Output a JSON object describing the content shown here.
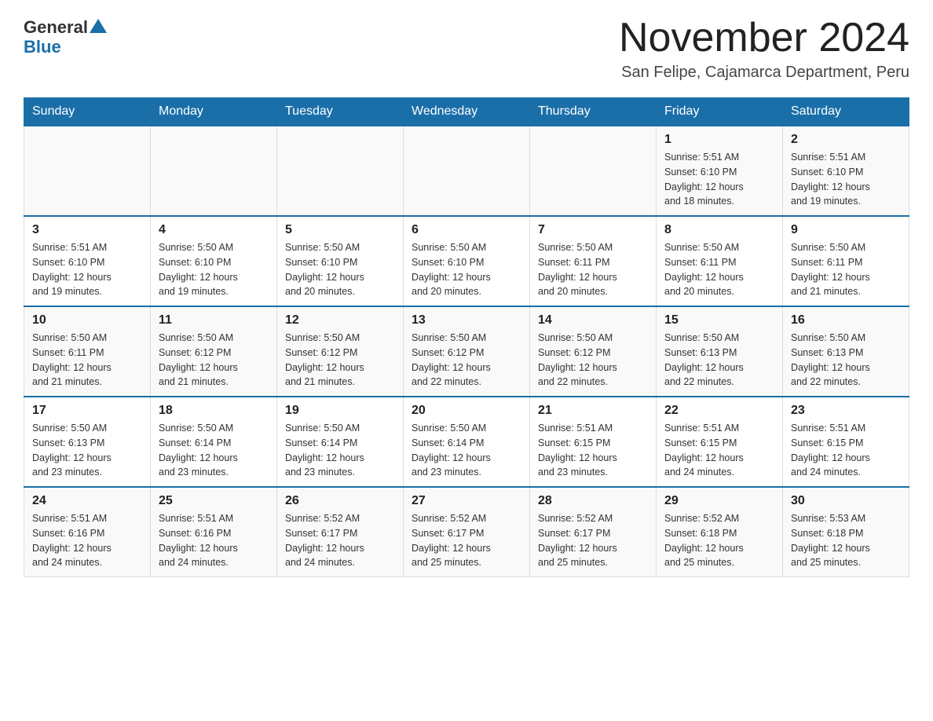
{
  "header": {
    "logo_general": "General",
    "logo_blue": "Blue",
    "month_title": "November 2024",
    "location": "San Felipe, Cajamarca Department, Peru"
  },
  "weekdays": [
    "Sunday",
    "Monday",
    "Tuesday",
    "Wednesday",
    "Thursday",
    "Friday",
    "Saturday"
  ],
  "weeks": [
    {
      "days": [
        {
          "number": "",
          "info": ""
        },
        {
          "number": "",
          "info": ""
        },
        {
          "number": "",
          "info": ""
        },
        {
          "number": "",
          "info": ""
        },
        {
          "number": "",
          "info": ""
        },
        {
          "number": "1",
          "info": "Sunrise: 5:51 AM\nSunset: 6:10 PM\nDaylight: 12 hours\nand 18 minutes."
        },
        {
          "number": "2",
          "info": "Sunrise: 5:51 AM\nSunset: 6:10 PM\nDaylight: 12 hours\nand 19 minutes."
        }
      ]
    },
    {
      "days": [
        {
          "number": "3",
          "info": "Sunrise: 5:51 AM\nSunset: 6:10 PM\nDaylight: 12 hours\nand 19 minutes."
        },
        {
          "number": "4",
          "info": "Sunrise: 5:50 AM\nSunset: 6:10 PM\nDaylight: 12 hours\nand 19 minutes."
        },
        {
          "number": "5",
          "info": "Sunrise: 5:50 AM\nSunset: 6:10 PM\nDaylight: 12 hours\nand 20 minutes."
        },
        {
          "number": "6",
          "info": "Sunrise: 5:50 AM\nSunset: 6:10 PM\nDaylight: 12 hours\nand 20 minutes."
        },
        {
          "number": "7",
          "info": "Sunrise: 5:50 AM\nSunset: 6:11 PM\nDaylight: 12 hours\nand 20 minutes."
        },
        {
          "number": "8",
          "info": "Sunrise: 5:50 AM\nSunset: 6:11 PM\nDaylight: 12 hours\nand 20 minutes."
        },
        {
          "number": "9",
          "info": "Sunrise: 5:50 AM\nSunset: 6:11 PM\nDaylight: 12 hours\nand 21 minutes."
        }
      ]
    },
    {
      "days": [
        {
          "number": "10",
          "info": "Sunrise: 5:50 AM\nSunset: 6:11 PM\nDaylight: 12 hours\nand 21 minutes."
        },
        {
          "number": "11",
          "info": "Sunrise: 5:50 AM\nSunset: 6:12 PM\nDaylight: 12 hours\nand 21 minutes."
        },
        {
          "number": "12",
          "info": "Sunrise: 5:50 AM\nSunset: 6:12 PM\nDaylight: 12 hours\nand 21 minutes."
        },
        {
          "number": "13",
          "info": "Sunrise: 5:50 AM\nSunset: 6:12 PM\nDaylight: 12 hours\nand 22 minutes."
        },
        {
          "number": "14",
          "info": "Sunrise: 5:50 AM\nSunset: 6:12 PM\nDaylight: 12 hours\nand 22 minutes."
        },
        {
          "number": "15",
          "info": "Sunrise: 5:50 AM\nSunset: 6:13 PM\nDaylight: 12 hours\nand 22 minutes."
        },
        {
          "number": "16",
          "info": "Sunrise: 5:50 AM\nSunset: 6:13 PM\nDaylight: 12 hours\nand 22 minutes."
        }
      ]
    },
    {
      "days": [
        {
          "number": "17",
          "info": "Sunrise: 5:50 AM\nSunset: 6:13 PM\nDaylight: 12 hours\nand 23 minutes."
        },
        {
          "number": "18",
          "info": "Sunrise: 5:50 AM\nSunset: 6:14 PM\nDaylight: 12 hours\nand 23 minutes."
        },
        {
          "number": "19",
          "info": "Sunrise: 5:50 AM\nSunset: 6:14 PM\nDaylight: 12 hours\nand 23 minutes."
        },
        {
          "number": "20",
          "info": "Sunrise: 5:50 AM\nSunset: 6:14 PM\nDaylight: 12 hours\nand 23 minutes."
        },
        {
          "number": "21",
          "info": "Sunrise: 5:51 AM\nSunset: 6:15 PM\nDaylight: 12 hours\nand 23 minutes."
        },
        {
          "number": "22",
          "info": "Sunrise: 5:51 AM\nSunset: 6:15 PM\nDaylight: 12 hours\nand 24 minutes."
        },
        {
          "number": "23",
          "info": "Sunrise: 5:51 AM\nSunset: 6:15 PM\nDaylight: 12 hours\nand 24 minutes."
        }
      ]
    },
    {
      "days": [
        {
          "number": "24",
          "info": "Sunrise: 5:51 AM\nSunset: 6:16 PM\nDaylight: 12 hours\nand 24 minutes."
        },
        {
          "number": "25",
          "info": "Sunrise: 5:51 AM\nSunset: 6:16 PM\nDaylight: 12 hours\nand 24 minutes."
        },
        {
          "number": "26",
          "info": "Sunrise: 5:52 AM\nSunset: 6:17 PM\nDaylight: 12 hours\nand 24 minutes."
        },
        {
          "number": "27",
          "info": "Sunrise: 5:52 AM\nSunset: 6:17 PM\nDaylight: 12 hours\nand 25 minutes."
        },
        {
          "number": "28",
          "info": "Sunrise: 5:52 AM\nSunset: 6:17 PM\nDaylight: 12 hours\nand 25 minutes."
        },
        {
          "number": "29",
          "info": "Sunrise: 5:52 AM\nSunset: 6:18 PM\nDaylight: 12 hours\nand 25 minutes."
        },
        {
          "number": "30",
          "info": "Sunrise: 5:53 AM\nSunset: 6:18 PM\nDaylight: 12 hours\nand 25 minutes."
        }
      ]
    }
  ]
}
